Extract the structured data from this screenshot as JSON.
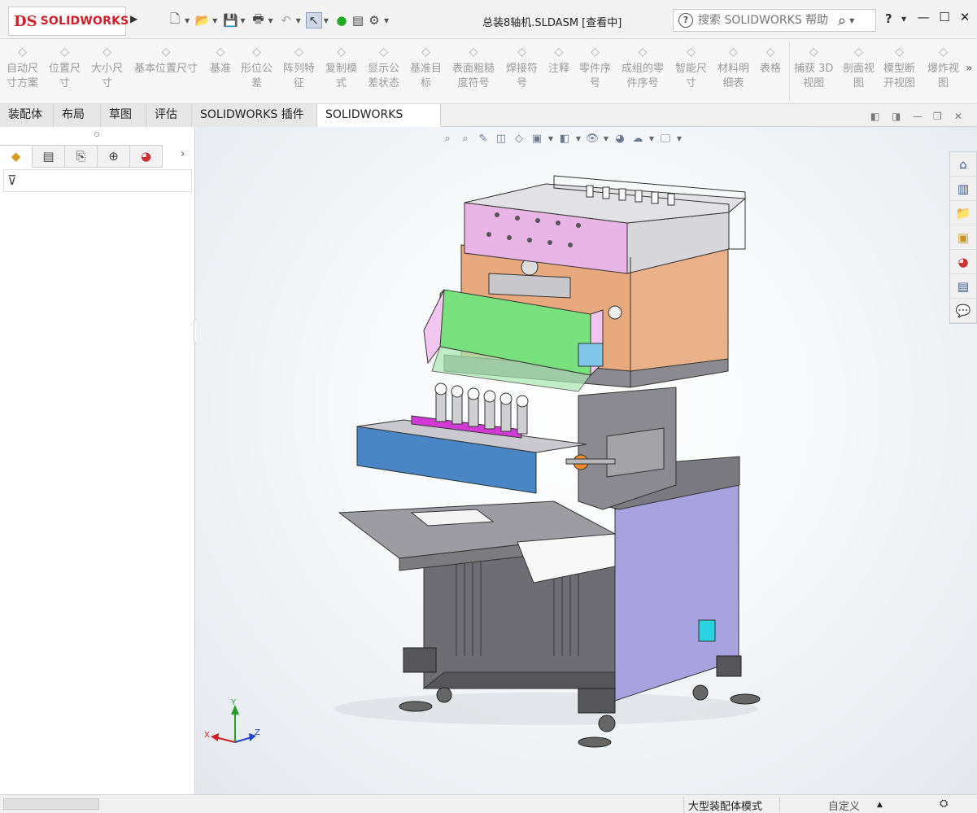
{
  "app": {
    "logo_mark": "DS",
    "logo_text": "SOLIDWORKS"
  },
  "window": {
    "title": "总装8轴机.SLDASM [查看中]"
  },
  "search": {
    "placeholder": "搜索 SOLIDWORKS 帮助"
  },
  "help": {
    "label": "?"
  },
  "ribbon": {
    "items": [
      {
        "label": "自动尺\n寸方案",
        "icon": "auto-dimension-icon"
      },
      {
        "label": "位置尺\n寸",
        "icon": "location-dimension-icon"
      },
      {
        "label": "大小尺\n寸",
        "icon": "size-dimension-icon"
      },
      {
        "label": "基本位置尺寸",
        "icon": "basic-location-dimension-icon"
      },
      {
        "label": "基准",
        "icon": "datum-icon"
      },
      {
        "label": "形位公\n差",
        "icon": "geometric-tolerance-icon"
      },
      {
        "label": "阵列特\n征",
        "icon": "pattern-feature-icon"
      },
      {
        "label": "复制模\n式",
        "icon": "copy-scheme-icon"
      },
      {
        "label": "显示公\n差状态",
        "icon": "show-tolerance-status-icon"
      },
      {
        "label": "基准目\n标",
        "icon": "datum-target-icon"
      },
      {
        "label": "表面粗糙\n度符号",
        "icon": "surface-finish-icon"
      },
      {
        "label": "焊接符\n号",
        "icon": "weld-symbol-icon"
      },
      {
        "label": "注释",
        "icon": "note-icon"
      },
      {
        "label": "零件序\n号",
        "icon": "balloon-icon"
      },
      {
        "label": "成组的零\n件序号",
        "icon": "stacked-balloon-icon"
      },
      {
        "label": "智能尺\n寸",
        "icon": "smart-dimension-icon"
      },
      {
        "label": "材料明\n细表",
        "icon": "bom-icon"
      },
      {
        "label": "表格",
        "icon": "table-icon"
      },
      {
        "label": "捕获 3D\n视图",
        "icon": "capture-3d-view-icon"
      },
      {
        "label": "剖面视\n图",
        "icon": "section-view-icon"
      },
      {
        "label": "模型断\n开视图",
        "icon": "model-break-view-icon"
      },
      {
        "label": "爆炸视\n图",
        "icon": "exploded-view-icon"
      }
    ]
  },
  "tabs": [
    {
      "label": "装配体"
    },
    {
      "label": "布局"
    },
    {
      "label": "草图"
    },
    {
      "label": "评估"
    },
    {
      "label": "SOLIDWORKS 插件"
    },
    {
      "label": "SOLIDWORKS MBD"
    }
  ],
  "triad": {
    "x": "X",
    "y": "Y",
    "z": "Z"
  },
  "status": {
    "mode": "大型装配体模式",
    "custom": "自定义"
  },
  "colors": {
    "accent": "#d0202a",
    "pink_panel": "#e9b5e6",
    "orange_panel": "#e9a97e",
    "green_panel": "#78e07c",
    "blue_bar": "#4a86c6",
    "lavender_cabinet": "#a9a2e0",
    "dark_base": "#6d6d73"
  }
}
